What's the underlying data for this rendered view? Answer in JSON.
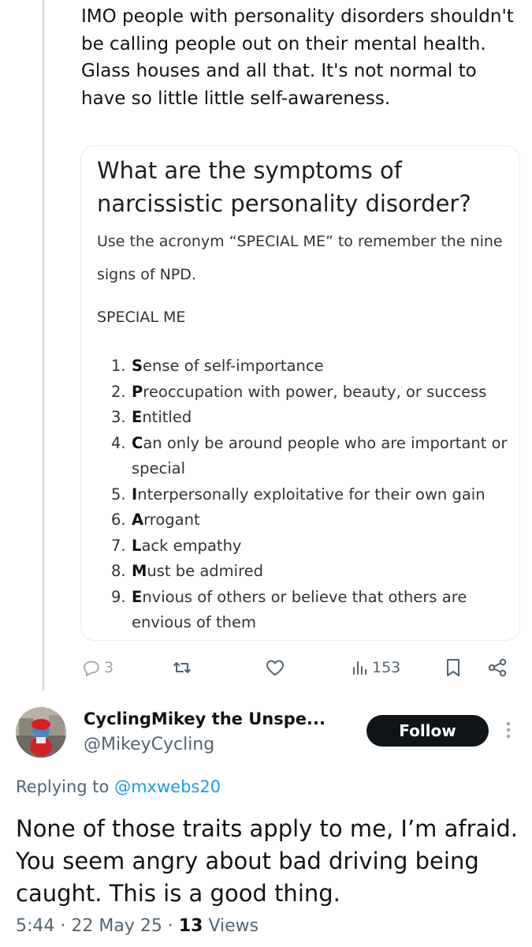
{
  "parent_tweet": {
    "text": "IMO people with personality disorders shouldn't be calling people out on their mental health. Glass houses and all that. It's not normal to have so little little self-awareness.",
    "media": {
      "title": "What are the symptoms of narcissistic personality disorder?",
      "subtitle": "Use the acronym “SPECIAL ME” to remember the nine signs of NPD.",
      "acronym_heading": "SPECIAL ME",
      "items": [
        {
          "num": "1.",
          "letter": "S",
          "rest": "ense of self-importance"
        },
        {
          "num": "2.",
          "letter": "P",
          "rest": "reoccupation with power, beauty, or success"
        },
        {
          "num": "3.",
          "letter": "E",
          "rest": "ntitled"
        },
        {
          "num": "4.",
          "letter": "C",
          "rest": "an only be around people who are important or special"
        },
        {
          "num": "5.",
          "letter": "I",
          "rest": "nterpersonally exploitative for their own gain"
        },
        {
          "num": "6.",
          "letter": "A",
          "rest": "rrogant"
        },
        {
          "num": "7.",
          "letter": "L",
          "rest": "ack empathy"
        },
        {
          "num": "8.",
          "letter": "M",
          "rest": "ust be admired"
        },
        {
          "num": "9.",
          "letter": "E",
          "rest": "nvious of others or believe that others are envious of them"
        }
      ]
    },
    "actions": {
      "reply_count": "3",
      "views_count": "153",
      "icons": [
        "reply-icon",
        "retweet-icon",
        "like-icon",
        "views-icon",
        "bookmark-icon",
        "share-icon"
      ]
    }
  },
  "reply_tweet": {
    "display_name": "CyclingMikey the Unspe...",
    "handle": "@MikeyCycling",
    "follow_label": "Follow",
    "replying_prefix": "Replying to",
    "replying_to": "@mxwebs20",
    "text": "None of those traits apply to me, I’m afraid. You seem angry about bad driving being caught. This is a good thing.",
    "time": "5:44",
    "date": "22 May 25",
    "views_count": "13",
    "views_label": "Views"
  },
  "colors": {
    "text": "#0f1419",
    "secondary": "#536471",
    "link": "#1d9bf0",
    "button": "#0f1419",
    "border": "#cfd9de"
  }
}
